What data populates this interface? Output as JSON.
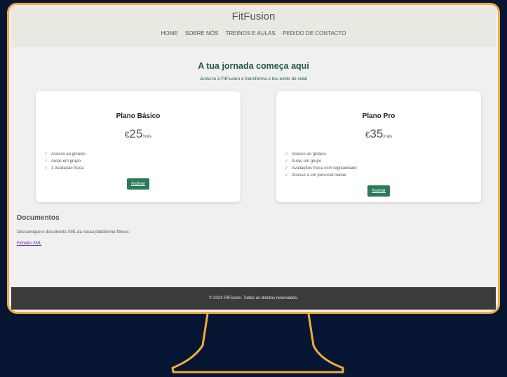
{
  "site": {
    "brand": "FitFusion",
    "nav": [
      "HOME",
      "SOBRE NÓS",
      "TREINOS E AULAS",
      "PEDIDO DE CONTACTO"
    ]
  },
  "hero": {
    "title": "A tua jornada começa aqui",
    "subtitle": "Junta-te à FitFusion e transforma o teu estilo de vida!"
  },
  "plans": [
    {
      "name": "Plano Básico",
      "currency": "€",
      "price": "25",
      "period": "/mês",
      "features": [
        "Acesso ao ginásio",
        "Aulas em grupo",
        "1 Avaliação física"
      ],
      "button": "Assinar"
    },
    {
      "name": "Plano Pro",
      "currency": "€",
      "price": "35",
      "period": "/mês",
      "features": [
        "Acesso ao ginásio",
        "Aulas em grupo",
        "Avaliações física com regularidade",
        "Acesso a um personal trainer"
      ],
      "button": "Assinar"
    }
  ],
  "documents": {
    "title": "Documentos",
    "description": "Descarregue o documento XML da nossa plataforma fitness:",
    "link": "Ficheiro XML"
  },
  "footer": {
    "text": "© 2024 FitFusion. Todos os direitos reservados."
  },
  "colors": {
    "background": "#061632",
    "frame": "#f0ab3c",
    "accent": "#2a7a58",
    "footer": "#3b3b3b"
  }
}
